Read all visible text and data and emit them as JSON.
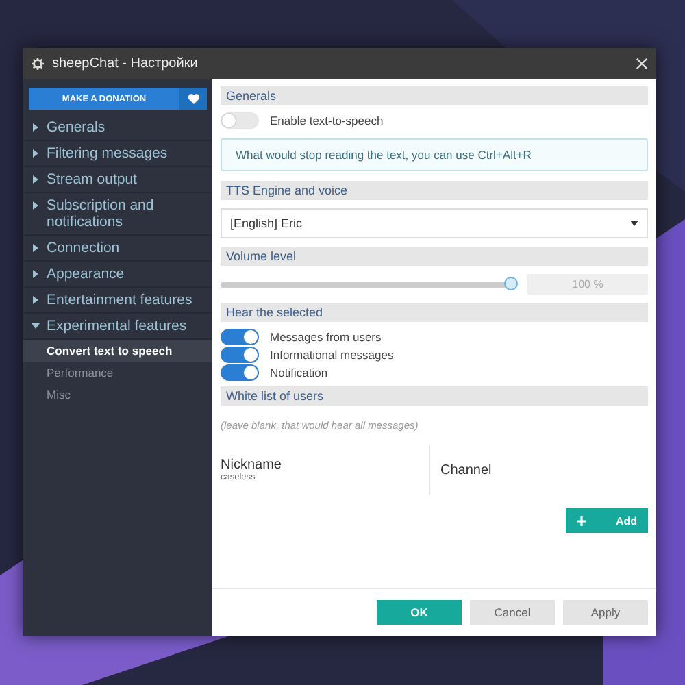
{
  "window": {
    "title": "sheepChat - Настройки"
  },
  "sidebar": {
    "donate_button": "MAKE A DONATION",
    "items": [
      {
        "label": "Generals",
        "expanded": false
      },
      {
        "label": "Filtering messages",
        "expanded": false
      },
      {
        "label": "Stream output",
        "expanded": false
      },
      {
        "label": "Subscription and notifications",
        "expanded": false
      },
      {
        "label": "Connection",
        "expanded": false
      },
      {
        "label": "Appearance",
        "expanded": false
      },
      {
        "label": "Entertainment features",
        "expanded": false
      },
      {
        "label": "Experimental features",
        "expanded": true,
        "children": [
          {
            "label": "Convert text to speech",
            "selected": true
          },
          {
            "label": "Performance",
            "selected": false
          },
          {
            "label": "Misc",
            "selected": false
          }
        ]
      }
    ]
  },
  "generals": {
    "title": "Generals",
    "toggle": {
      "label": "Enable text-to-speech",
      "on": false
    },
    "info": "What would stop reading the text, you can use Ctrl+Alt+R"
  },
  "engine": {
    "title": "TTS Engine and voice",
    "value": "[English] Eric"
  },
  "volume": {
    "title": "Volume level",
    "level": 1.0,
    "reading": "100 %"
  },
  "hear": {
    "title": "Hear the selected",
    "toggles": [
      {
        "label": "Messages from users",
        "on": true
      },
      {
        "label": "Informational messages",
        "on": true
      },
      {
        "label": "Notification",
        "on": true
      }
    ]
  },
  "whitelist": {
    "title": "White list of users",
    "hint": "(leave blank, that would hear all messages)",
    "columns": [
      {
        "label": "Nickname",
        "sublabel": "caseless"
      },
      {
        "label": "Channel"
      }
    ],
    "add_button": "Add"
  },
  "buttons": [
    {
      "label": "OK",
      "kind": "primary"
    },
    {
      "label": "Cancel",
      "kind": "secondary"
    },
    {
      "label": "Apply",
      "kind": "secondary"
    }
  ]
}
